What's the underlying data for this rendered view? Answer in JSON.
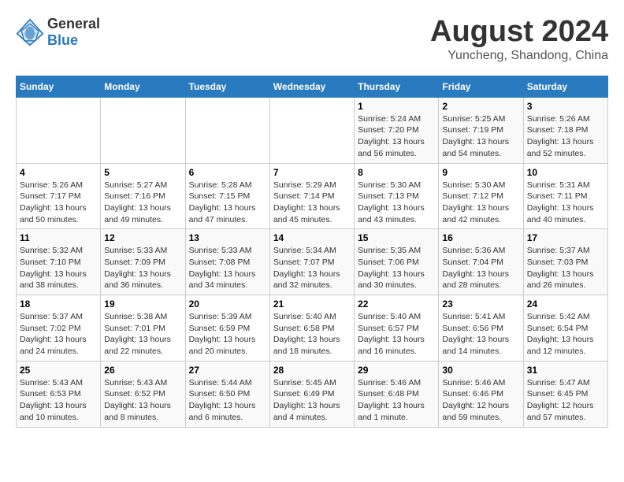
{
  "header": {
    "logo_general": "General",
    "logo_blue": "Blue",
    "main_title": "August 2024",
    "subtitle": "Yuncheng, Shandong, China"
  },
  "calendar": {
    "columns": [
      "Sunday",
      "Monday",
      "Tuesday",
      "Wednesday",
      "Thursday",
      "Friday",
      "Saturday"
    ],
    "rows": [
      [
        {
          "day": "",
          "info": ""
        },
        {
          "day": "",
          "info": ""
        },
        {
          "day": "",
          "info": ""
        },
        {
          "day": "",
          "info": ""
        },
        {
          "day": "1",
          "info": "Sunrise: 5:24 AM\nSunset: 7:20 PM\nDaylight: 13 hours\nand 56 minutes."
        },
        {
          "day": "2",
          "info": "Sunrise: 5:25 AM\nSunset: 7:19 PM\nDaylight: 13 hours\nand 54 minutes."
        },
        {
          "day": "3",
          "info": "Sunrise: 5:26 AM\nSunset: 7:18 PM\nDaylight: 13 hours\nand 52 minutes."
        }
      ],
      [
        {
          "day": "4",
          "info": "Sunrise: 5:26 AM\nSunset: 7:17 PM\nDaylight: 13 hours\nand 50 minutes."
        },
        {
          "day": "5",
          "info": "Sunrise: 5:27 AM\nSunset: 7:16 PM\nDaylight: 13 hours\nand 49 minutes."
        },
        {
          "day": "6",
          "info": "Sunrise: 5:28 AM\nSunset: 7:15 PM\nDaylight: 13 hours\nand 47 minutes."
        },
        {
          "day": "7",
          "info": "Sunrise: 5:29 AM\nSunset: 7:14 PM\nDaylight: 13 hours\nand 45 minutes."
        },
        {
          "day": "8",
          "info": "Sunrise: 5:30 AM\nSunset: 7:13 PM\nDaylight: 13 hours\nand 43 minutes."
        },
        {
          "day": "9",
          "info": "Sunrise: 5:30 AM\nSunset: 7:12 PM\nDaylight: 13 hours\nand 42 minutes."
        },
        {
          "day": "10",
          "info": "Sunrise: 5:31 AM\nSunset: 7:11 PM\nDaylight: 13 hours\nand 40 minutes."
        }
      ],
      [
        {
          "day": "11",
          "info": "Sunrise: 5:32 AM\nSunset: 7:10 PM\nDaylight: 13 hours\nand 38 minutes."
        },
        {
          "day": "12",
          "info": "Sunrise: 5:33 AM\nSunset: 7:09 PM\nDaylight: 13 hours\nand 36 minutes."
        },
        {
          "day": "13",
          "info": "Sunrise: 5:33 AM\nSunset: 7:08 PM\nDaylight: 13 hours\nand 34 minutes."
        },
        {
          "day": "14",
          "info": "Sunrise: 5:34 AM\nSunset: 7:07 PM\nDaylight: 13 hours\nand 32 minutes."
        },
        {
          "day": "15",
          "info": "Sunrise: 5:35 AM\nSunset: 7:06 PM\nDaylight: 13 hours\nand 30 minutes."
        },
        {
          "day": "16",
          "info": "Sunrise: 5:36 AM\nSunset: 7:04 PM\nDaylight: 13 hours\nand 28 minutes."
        },
        {
          "day": "17",
          "info": "Sunrise: 5:37 AM\nSunset: 7:03 PM\nDaylight: 13 hours\nand 26 minutes."
        }
      ],
      [
        {
          "day": "18",
          "info": "Sunrise: 5:37 AM\nSunset: 7:02 PM\nDaylight: 13 hours\nand 24 minutes."
        },
        {
          "day": "19",
          "info": "Sunrise: 5:38 AM\nSunset: 7:01 PM\nDaylight: 13 hours\nand 22 minutes."
        },
        {
          "day": "20",
          "info": "Sunrise: 5:39 AM\nSunset: 6:59 PM\nDaylight: 13 hours\nand 20 minutes."
        },
        {
          "day": "21",
          "info": "Sunrise: 5:40 AM\nSunset: 6:58 PM\nDaylight: 13 hours\nand 18 minutes."
        },
        {
          "day": "22",
          "info": "Sunrise: 5:40 AM\nSunset: 6:57 PM\nDaylight: 13 hours\nand 16 minutes."
        },
        {
          "day": "23",
          "info": "Sunrise: 5:41 AM\nSunset: 6:56 PM\nDaylight: 13 hours\nand 14 minutes."
        },
        {
          "day": "24",
          "info": "Sunrise: 5:42 AM\nSunset: 6:54 PM\nDaylight: 13 hours\nand 12 minutes."
        }
      ],
      [
        {
          "day": "25",
          "info": "Sunrise: 5:43 AM\nSunset: 6:53 PM\nDaylight: 13 hours\nand 10 minutes."
        },
        {
          "day": "26",
          "info": "Sunrise: 5:43 AM\nSunset: 6:52 PM\nDaylight: 13 hours\nand 8 minutes."
        },
        {
          "day": "27",
          "info": "Sunrise: 5:44 AM\nSunset: 6:50 PM\nDaylight: 13 hours\nand 6 minutes."
        },
        {
          "day": "28",
          "info": "Sunrise: 5:45 AM\nSunset: 6:49 PM\nDaylight: 13 hours\nand 4 minutes."
        },
        {
          "day": "29",
          "info": "Sunrise: 5:46 AM\nSunset: 6:48 PM\nDaylight: 13 hours\nand 1 minute."
        },
        {
          "day": "30",
          "info": "Sunrise: 5:46 AM\nSunset: 6:46 PM\nDaylight: 12 hours\nand 59 minutes."
        },
        {
          "day": "31",
          "info": "Sunrise: 5:47 AM\nSunset: 6:45 PM\nDaylight: 12 hours\nand 57 minutes."
        }
      ]
    ]
  }
}
